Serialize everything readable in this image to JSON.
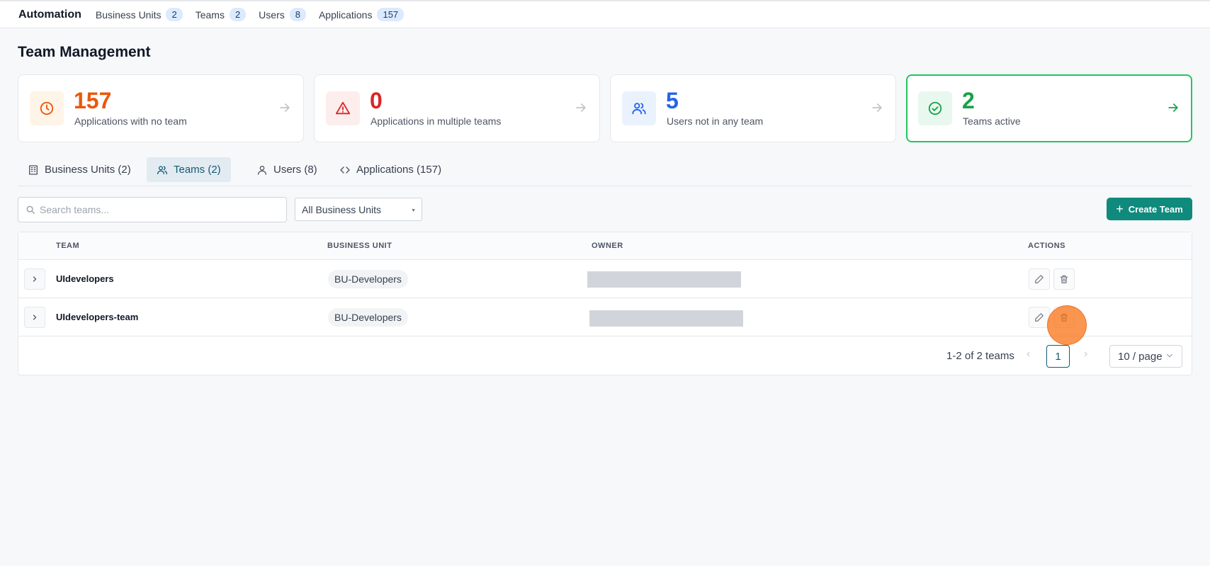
{
  "topnav": {
    "brand": "Automation",
    "items": [
      {
        "label": "Business Units",
        "count": "2"
      },
      {
        "label": "Teams",
        "count": "2"
      },
      {
        "label": "Users",
        "count": "8"
      },
      {
        "label": "Applications",
        "count": "157"
      }
    ]
  },
  "page": {
    "title": "Team Management"
  },
  "cards": [
    {
      "value": "157",
      "label": "Applications with no team",
      "icon": "clock-icon",
      "color": "#ea580c"
    },
    {
      "value": "0",
      "label": "Applications in multiple teams",
      "icon": "warning-icon",
      "color": "#dc2626"
    },
    {
      "value": "5",
      "label": "Users not in any team",
      "icon": "users-icon",
      "color": "#2563eb"
    },
    {
      "value": "2",
      "label": "Teams active",
      "icon": "check-circle-icon",
      "color": "#16a34a"
    }
  ],
  "tabs": [
    {
      "label": "Business Units (2)",
      "icon": "building-icon"
    },
    {
      "label": "Teams (2)",
      "icon": "users-icon",
      "active": true
    },
    {
      "label": "Users (8)",
      "icon": "user-icon"
    },
    {
      "label": "Applications (157)",
      "icon": "code-icon"
    }
  ],
  "toolbar": {
    "search_placeholder": "Search teams...",
    "filter_value": "All Business Units",
    "create_label": "Create Team"
  },
  "table": {
    "columns": [
      "TEAM",
      "BUSINESS UNIT",
      "OWNER",
      "ACTIONS"
    ],
    "rows": [
      {
        "team": "UIdevelopers",
        "business_unit": "BU-Developers"
      },
      {
        "team": "UIdevelopers-team",
        "business_unit": "BU-Developers"
      }
    ]
  },
  "pagination": {
    "summary": "1-2 of 2 teams",
    "current_page": "1",
    "page_size": "10 / page"
  },
  "colors": {
    "accent": "#0f8a7c",
    "tab_active": "#135a73"
  }
}
